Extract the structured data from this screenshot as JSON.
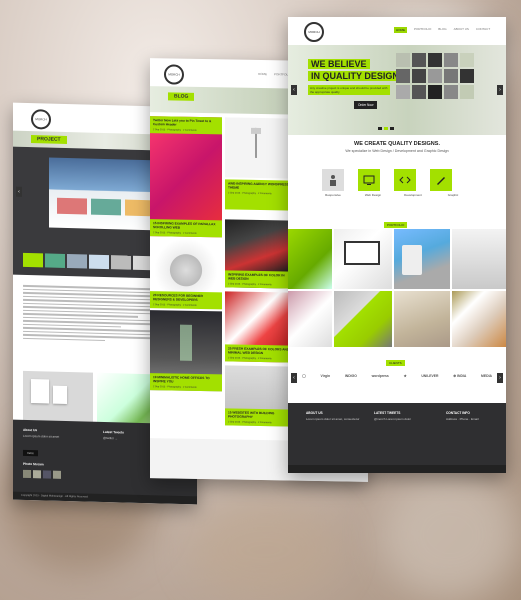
{
  "left_page": {
    "logo": "MORCH",
    "section_label": "PROJECT",
    "about_title": "About Us",
    "latest_title": "Latest Tweets",
    "photo_title": "Photo Stream",
    "more_button": "more",
    "copyright": "Copyright 2013 · Digital Mohanasign · All Rights Reserved"
  },
  "mid_page": {
    "logo": "MORCH",
    "nav": [
      "HOME",
      "PORTFOLIO",
      "BLOG"
    ],
    "section_label": "BLOG",
    "posts": [
      {
        "title": "Twitter Now Lets you to Pin Tweet to & Custom Header",
        "meta": "2 Sep 2013 · Photography · 2 Comments"
      },
      {
        "title": "15 INSPIRING EXAMPLES OF PARALLAX SCROLLING WEB",
        "meta": "2 Sep 2013 · Photography · 2 Comments"
      },
      {
        "title": "AWE-INSPIRING AGENCY WORDPRESS THEME",
        "meta": "2 Sep 2013 · Photography · 2 Comments"
      },
      {
        "title": "20 RESOURCES FOR BEGINNER DESIGNERS & DEVELOPERS",
        "meta": "2 Sep 2013 · Photography · 2 Comments"
      },
      {
        "title": "INSPIRING EXAMPLES OF COLOR IN WEB DESIGN",
        "meta": "2 Sep 2013 · Photography · 2 Comments"
      },
      {
        "title": "19 MINIMALISTIC HOME OFFICES TO INSPIRE YOU",
        "meta": "2 Sep 2013 · Photography · 2 Comments"
      },
      {
        "title": "25 FRESH EXAMPLES OF COLORS AND MINIMAL WEB DESIGN",
        "meta": "2 Sep 2013 · Photography · 2 Comments"
      },
      {
        "title": "15 WEBSITES WITH BUILDING PHOTOGRAPHY",
        "meta": "2 Sep 2013 · Photography · 2 Comments"
      }
    ]
  },
  "right_page": {
    "logo": "MORCH",
    "nav": [
      "HOME",
      "PORTFOLIO",
      "BLOG",
      "ABOUT US",
      "CONTACT"
    ],
    "hero_line1": "WE BELIEVE",
    "hero_line2": "IN QUALITY DESIGN",
    "hero_sub": "Any creative project is unique and should be provided with the appropriate quality",
    "hero_button": "Order Now",
    "section_title": "WE CREATE QUALITY DESIGNS.",
    "section_sub": "We specialize in Web Design / Development and Graphic Design",
    "features": [
      "Responsive",
      "Web Design",
      "Development",
      "Graphic"
    ],
    "portfolio_label": "PORTFOLIO",
    "clients_label": "CLIENTS",
    "client_logos": [
      "◯",
      "Virgin",
      "INDIGO",
      "wordpress",
      "★",
      "UNILEVER",
      "⊕ INDIA",
      "MEDIA"
    ],
    "footer_cols": [
      "ABOUT US",
      "LATEST TWEETS",
      "CONTACT INFO"
    ]
  },
  "colors": {
    "accent": "#a3e000",
    "dark": "#2f2f31"
  }
}
